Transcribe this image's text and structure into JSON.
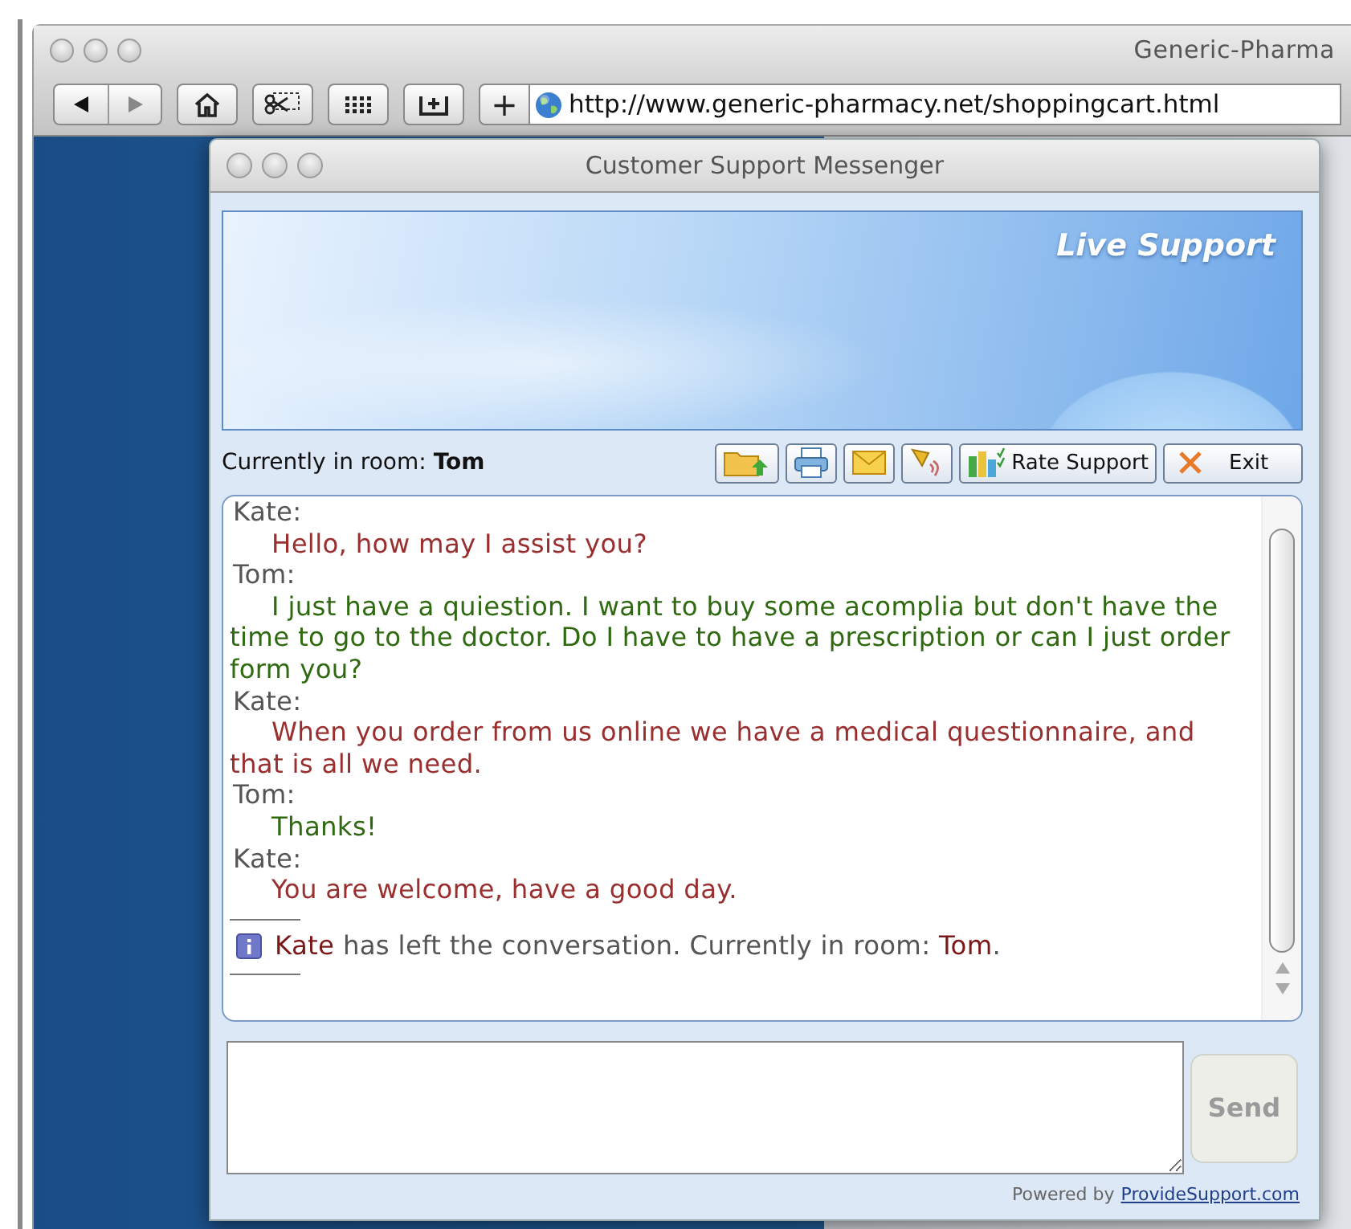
{
  "browser": {
    "title": "Generic-Pharma",
    "url": "http://www.generic-pharmacy.net/shoppingcart.html",
    "add_button": "+"
  },
  "messenger": {
    "title": "Customer Support Messenger",
    "banner_title": "Live Support",
    "room": {
      "label": "Currently in room:",
      "name": "Tom"
    },
    "tools": [
      {
        "kind": "upload"
      },
      {
        "kind": "print"
      },
      {
        "kind": "email"
      },
      {
        "kind": "sound"
      },
      {
        "kind": "rate",
        "label": "Rate Support"
      },
      {
        "kind": "exit",
        "label": "Exit"
      }
    ],
    "messages": [
      {
        "kind": "agent",
        "sender": "Kate:",
        "text": "Hello, how may I assist you?"
      },
      {
        "kind": "visitor",
        "sender": "Tom:",
        "text": "I just have a quiestion. I want to buy some acomplia but don't have the time to go to the doctor. Do I have to have a prescription or can I just order form you?"
      },
      {
        "kind": "agent",
        "sender": "Kate:",
        "text": "When you order from us online we have a medical questionnaire, and that is all we need."
      },
      {
        "kind": "visitor",
        "sender": "Tom:",
        "text": "Thanks!"
      },
      {
        "kind": "agent",
        "sender": "Kate:",
        "text": "You are welcome, have a good day."
      }
    ],
    "notice": {
      "actor": "Kate",
      "text": "has left the conversation. Currently in room:",
      "room": "Tom",
      "end": "."
    },
    "send_button": {
      "label": "Send",
      "disabled": true
    },
    "footer": {
      "text": "Powered by",
      "link": "ProvideSupport.com"
    }
  }
}
